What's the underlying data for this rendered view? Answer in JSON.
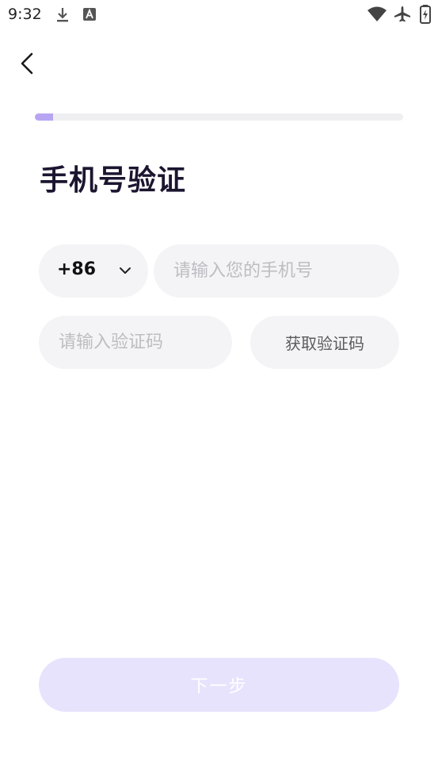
{
  "status_bar": {
    "time": "9:32",
    "icons": [
      "download-icon",
      "font-a-icon",
      "wifi-icon",
      "airplane-icon",
      "battery-charging-icon"
    ]
  },
  "navigation": {
    "back_icon": "chevron-left-icon"
  },
  "progress": {
    "value": 0.05,
    "fill_color": "#b7a5f3",
    "track_color": "#efeff1"
  },
  "page": {
    "title": "手机号验证"
  },
  "form": {
    "country_code": "+86",
    "phone_placeholder": "请输入您的手机号",
    "phone_value": "",
    "sms_code_placeholder": "请输入验证码",
    "sms_code_value": "",
    "get_code_label": "获取验证码"
  },
  "footer": {
    "next_label": "下一步"
  },
  "colors": {
    "accent": "#b7a5f3",
    "next_button_disabled_bg": "#e8e3fd",
    "field_bg": "#f4f4f6",
    "title": "#1c1530"
  }
}
